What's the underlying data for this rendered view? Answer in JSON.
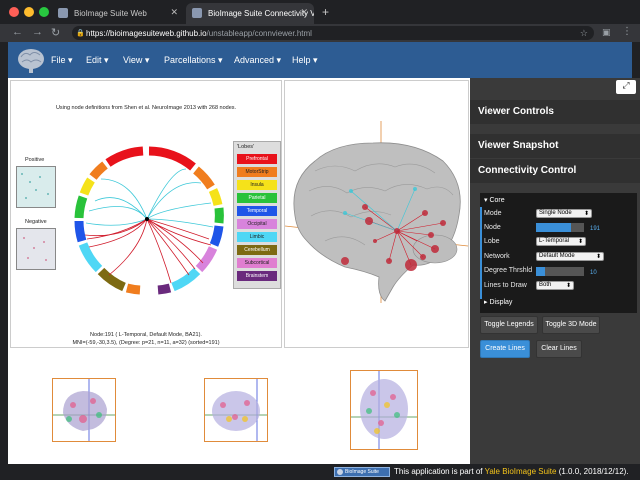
{
  "browser": {
    "tabs": [
      {
        "title": "BioImage Suite Web"
      },
      {
        "title": "BioImage Suite Connectivity V"
      }
    ],
    "url_host": "https://bioimagesuiteweb.github.io",
    "url_path": "/unstableapp/connviewer.html",
    "new_tab": "+"
  },
  "menubar": {
    "items": [
      "File",
      "Edit",
      "View",
      "Parcellations",
      "Advanced",
      "Help"
    ]
  },
  "connectivity": {
    "caption": "Using node definitions from Shen et al. NeuroImage 2013 with 268 nodes.",
    "positive_label": "Positive",
    "negative_label": "Negative",
    "node_info_line1": "Node:191 ( L-Temporal, Default Mode, BA21).",
    "node_info_line2": "MNI=(-59,-30,3.5), (Degree: p=21, n=11, a=32) (sorted=191)",
    "legend_title": "'Lobes'",
    "lobes": [
      {
        "name": "Prefrontal",
        "color": "#e8121b"
      },
      {
        "name": "MotorStrip",
        "color": "#f07d1e"
      },
      {
        "name": "Insula",
        "color": "#f5e21a"
      },
      {
        "name": "Parietal",
        "color": "#29c23a"
      },
      {
        "name": "Temporal",
        "color": "#1f55e8"
      },
      {
        "name": "Occipital",
        "color": "#d883dc"
      },
      {
        "name": "Limbic",
        "color": "#4fd7f5"
      },
      {
        "name": "Cerebellum",
        "color": "#7d6a12"
      },
      {
        "name": "Subcortical",
        "color": "#e07ed0"
      },
      {
        "name": "Brainstem",
        "color": "#6a2a7d"
      }
    ]
  },
  "panel": {
    "viewer_controls": "Viewer Controls",
    "viewer_snapshot": "Viewer Snapshot",
    "connectivity_control": "Connectivity Control",
    "core_label": "Core",
    "rows": {
      "mode": {
        "label": "Mode",
        "value": "Single Node"
      },
      "node": {
        "label": "Node",
        "value": "191",
        "fraction": 0.72
      },
      "lobe": {
        "label": "Lobe",
        "value": "L-Temporal"
      },
      "network": {
        "label": "Network",
        "value": "Default Mode"
      },
      "degree": {
        "label": "Degree Thrshld",
        "value": "10",
        "fraction": 0.18
      },
      "lines": {
        "label": "Lines to Draw",
        "value": "Both"
      }
    },
    "display_label": "Display",
    "buttons": {
      "toggle_legends": "Toggle Legends",
      "toggle_3d": "Toggle 3D Mode",
      "create_lines": "Create Lines",
      "clear_lines": "Clear Lines"
    },
    "colors": {
      "accent": "#3a8fd8",
      "core_bar": "#3a8fd8"
    }
  },
  "footer": {
    "badge": "BioImage Suite",
    "text_prefix": "This application is part of",
    "link": "Yale BioImage Suite",
    "text_suffix": "(1.0.0, 2018/12/12)."
  }
}
